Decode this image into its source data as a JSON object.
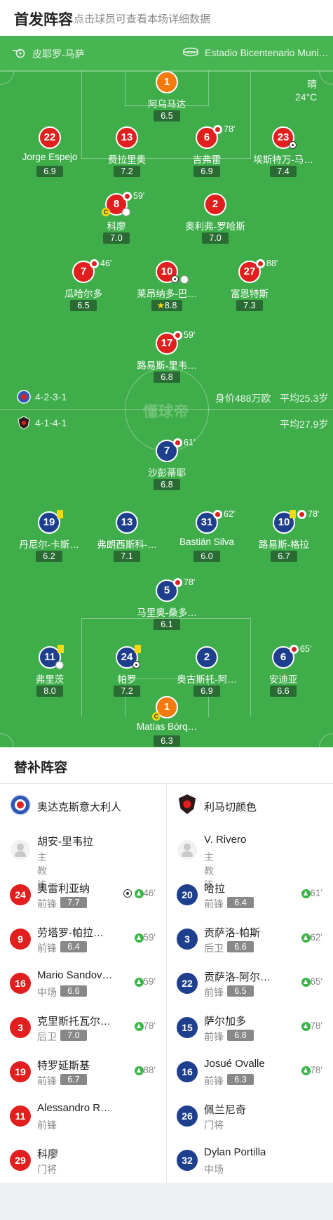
{
  "header": {
    "title": "首发阵容",
    "subtitle": "点击球员可查看本场详细数据"
  },
  "match": {
    "referee": "皮耶罗-马萨",
    "venue": "Estadio Bicentenario Muni…",
    "weather": "晴",
    "temperature": "24°C",
    "watermark": "懂球帝"
  },
  "home_team": {
    "name": "奥达克斯意大利人",
    "formation": "4-2-3-1",
    "value": "身价488万欧",
    "avg_age": "平均25.3岁",
    "coach": "胡安-里韦拉",
    "coach_role": "主教练"
  },
  "away_team": {
    "name": "利马切颜色",
    "formation": "4-1-4-1",
    "avg_age": "平均27.9岁",
    "coach": "V. Rivero",
    "coach_role": "主教练"
  },
  "home_players": [
    {
      "num": "1",
      "name": "阿乌马达",
      "rating": "6.5",
      "kit": "gk"
    },
    {
      "num": "22",
      "name": "Jorge Espejo",
      "rating": "6.9",
      "kit": "red"
    },
    {
      "num": "13",
      "name": "费拉里奥",
      "rating": "7.2",
      "kit": "red"
    },
    {
      "num": "6",
      "name": "吉弗雷",
      "rating": "6.9",
      "kit": "red",
      "sub_min": "78'"
    },
    {
      "num": "23",
      "name": "埃斯特万-马…",
      "rating": "7.4",
      "kit": "red"
    },
    {
      "num": "8",
      "name": "科廖",
      "rating": "7.0",
      "kit": "red",
      "sub_min": "59'"
    },
    {
      "num": "2",
      "name": "奥利弗-罗哈斯",
      "rating": "7.0",
      "kit": "red"
    },
    {
      "num": "7",
      "name": "瓜哈尔多",
      "rating": "6.5",
      "kit": "red",
      "sub_min": "46'"
    },
    {
      "num": "10",
      "name": "莱昂纳多-巴…",
      "rating": "8.8",
      "kit": "red"
    },
    {
      "num": "27",
      "name": "富恩特斯",
      "rating": "7.3",
      "kit": "red",
      "sub_min": "88'"
    },
    {
      "num": "17",
      "name": "路易斯-里韦…",
      "rating": "6.8",
      "kit": "red",
      "sub_min": "59'"
    }
  ],
  "away_players": [
    {
      "num": "7",
      "name": "沙彭蒂耶",
      "rating": "6.8",
      "kit": "blue",
      "sub_min": "61'"
    },
    {
      "num": "19",
      "name": "丹尼尔-卡斯…",
      "rating": "6.2",
      "kit": "blue"
    },
    {
      "num": "13",
      "name": "弗朗西斯科-…",
      "rating": "7.1",
      "kit": "blue"
    },
    {
      "num": "31",
      "name": "Bastián Silva",
      "rating": "6.0",
      "kit": "blue",
      "sub_min": "62'"
    },
    {
      "num": "10",
      "name": "路易斯-格拉",
      "rating": "6.7",
      "kit": "blue",
      "sub_min": "78'"
    },
    {
      "num": "5",
      "name": "马里奥-桑多…",
      "rating": "6.1",
      "kit": "blue",
      "sub_min": "78'"
    },
    {
      "num": "11",
      "name": "弗里茨",
      "rating": "8.0",
      "kit": "blue"
    },
    {
      "num": "24",
      "name": "帕罗",
      "rating": "7.2",
      "kit": "blue"
    },
    {
      "num": "2",
      "name": "奥古斯托-阿…",
      "rating": "6.9",
      "kit": "blue"
    },
    {
      "num": "6",
      "name": "安迪亚",
      "rating": "6.6",
      "kit": "blue",
      "sub_min": "65'"
    },
    {
      "num": "1",
      "name": "Matías Bórq…",
      "rating": "6.3",
      "kit": "gk"
    }
  ],
  "subs": {
    "title": "替补阵容",
    "home": [
      {
        "num": "24",
        "name": "奥雷利亚纳",
        "pos": "前锋",
        "rating": "7.7",
        "min": "46'"
      },
      {
        "num": "9",
        "name": "劳塔罗-帕拉…",
        "pos": "前锋",
        "rating": "6.4",
        "min": "59'"
      },
      {
        "num": "16",
        "name": "Mario Sandov…",
        "pos": "中场",
        "rating": "6.6",
        "min": "59'"
      },
      {
        "num": "3",
        "name": "克里斯托瓦尔…",
        "pos": "后卫",
        "rating": "7.0",
        "min": "78'"
      },
      {
        "num": "19",
        "name": "特罗延斯基",
        "pos": "前锋",
        "rating": "6.7",
        "min": "88'"
      },
      {
        "num": "11",
        "name": "Alessandro R…",
        "pos": "前锋"
      },
      {
        "num": "29",
        "name": "科廖",
        "pos": "门将"
      }
    ],
    "away": [
      {
        "num": "20",
        "name": "哈拉",
        "pos": "前锋",
        "rating": "6.4",
        "min": "61'"
      },
      {
        "num": "3",
        "name": "贡萨洛-帕斯",
        "pos": "后卫",
        "rating": "6.6",
        "min": "62'"
      },
      {
        "num": "22",
        "name": "贡萨洛-阿尔…",
        "pos": "前锋",
        "rating": "6.5",
        "min": "65'"
      },
      {
        "num": "15",
        "name": "萨尔加多",
        "pos": "前锋",
        "rating": "6.8",
        "min": "78'"
      },
      {
        "num": "16",
        "name": "Josué Ovalle",
        "pos": "前锋",
        "rating": "6.3",
        "min": "78'"
      },
      {
        "num": "26",
        "name": "佩兰尼奇",
        "pos": "门将"
      },
      {
        "num": "32",
        "name": "Dylan Portilla",
        "pos": "中场"
      }
    ]
  },
  "colors": {
    "pitch": "#3fae4a",
    "home_kit": "#e11f1f",
    "away_kit": "#1e3f8e",
    "gk_kit": "#f47a0e",
    "rating_bg": "#2a6b34"
  }
}
